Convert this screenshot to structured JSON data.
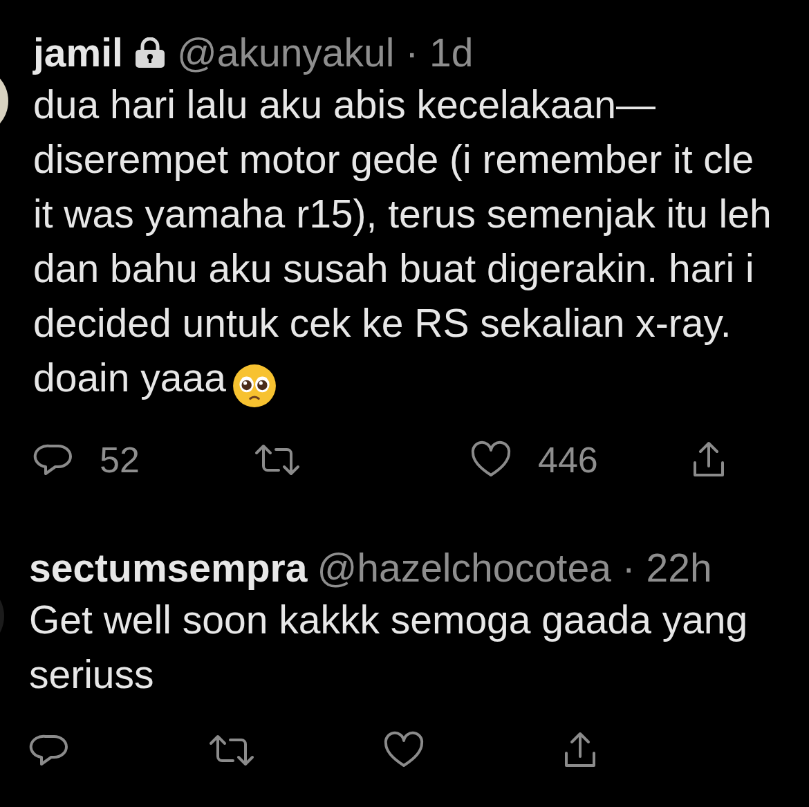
{
  "tweets": [
    {
      "name": "jamil",
      "locked": true,
      "handle_line": "@akunyakul · 1d",
      "text_lines": [
        "dua hari lalu aku abis kecelakaan—",
        "diserempet motor gede (i remember it cle",
        "it was yamaha r15), terus semenjak itu leh",
        "dan bahu aku susah buat digerakin. hari i",
        "decided untuk cek ke RS sekalian x-ray.",
        "doain yaaa"
      ],
      "emoji": true,
      "replies": "52",
      "likes": "446"
    },
    {
      "name": "sectumsempra",
      "locked": false,
      "handle_line": "@hazelchocotea · 22h",
      "text_lines": [
        "Get well soon kakkk semoga gaada yang",
        "seriuss"
      ],
      "emoji": false
    }
  ]
}
